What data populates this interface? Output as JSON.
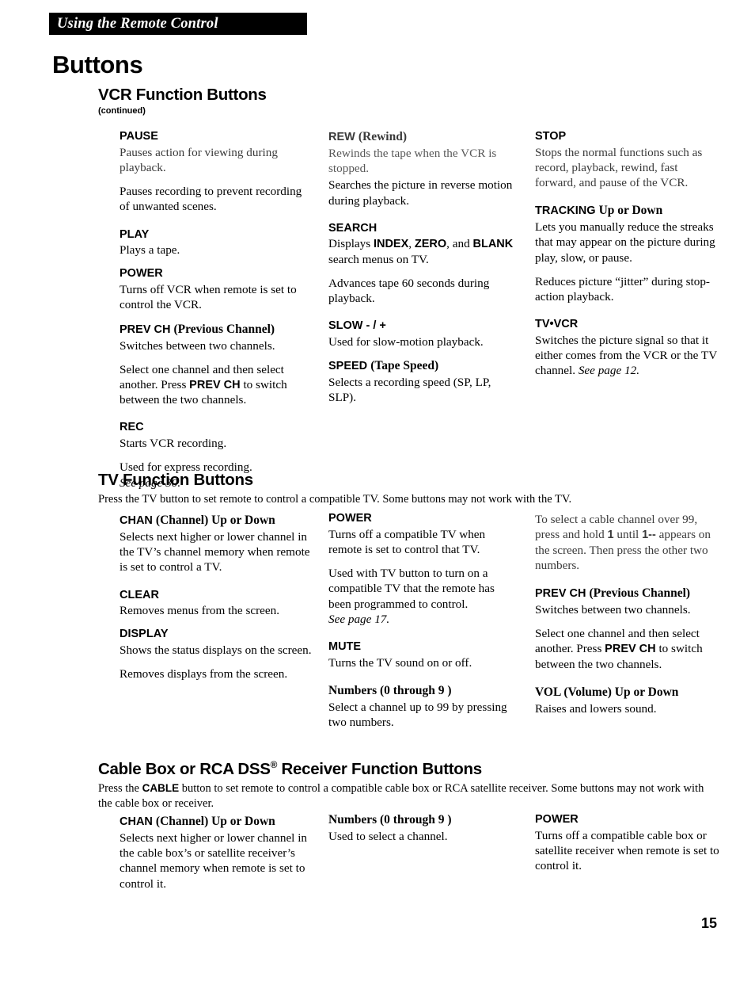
{
  "running_header": "Using the Remote Control",
  "chapter_title": "Buttons",
  "page_number": "15",
  "sections": [
    {
      "id": "vcr",
      "heading": "VCR Function Buttons",
      "subheading": "(continued)",
      "intro": "",
      "columns": [
        {
          "entries": [
            {
              "title": "PAUSE",
              "paragraphs": [
                "Pauses action for viewing during playback.",
                "Pauses recording to prevent recording of unwanted scenes."
              ]
            },
            {
              "title": "PLAY",
              "paragraphs": [
                "Plays a tape."
              ]
            },
            {
              "title": "POWER",
              "paragraphs": [
                "Turns off VCR when remote is set to control the VCR."
              ]
            },
            {
              "title": "PREV CH",
              "title_suffix": "(Previous Channel)",
              "paragraphs": [
                "Switches between two channels.",
                "Select one channel and then select another.  Press PREV CH to switch between the two channels."
              ]
            },
            {
              "title": "REC",
              "paragraphs": [
                "Starts VCR recording.",
                "Used for express recording.",
                "See page 30."
              ]
            }
          ]
        },
        {
          "entries": [
            {
              "title": "REW",
              "title_suffix": "(Rewind)",
              "paragraphs": [
                "Rewinds the tape when the VCR is stopped.",
                "Searches the picture in reverse motion during playback."
              ]
            },
            {
              "title": "SEARCH",
              "paragraphs": [
                "Displays INDEX, ZERO, and BLANK search menus on TV.",
                "Advances tape 60 seconds during playback."
              ]
            },
            {
              "title": "SLOW - / +",
              "paragraphs": [
                "Used for slow-motion playback."
              ]
            },
            {
              "title": "SPEED",
              "title_suffix": "(Tape Speed)",
              "paragraphs": [
                "Selects a recording speed (SP, LP, SLP)."
              ]
            }
          ]
        },
        {
          "entries": [
            {
              "title": "STOP",
              "paragraphs": [
                "Stops the normal functions such as record, playback, rewind, fast forward, and pause of the VCR."
              ]
            },
            {
              "title": "TRACKING",
              "title_suffix": "Up or Down",
              "paragraphs": [
                "Lets you manually reduce the streaks that may appear on the picture during play, slow, or pause.",
                "Reduces picture “jitter” during stop-action playback."
              ]
            },
            {
              "title": "TV•VCR",
              "paragraphs": [
                "Switches the picture signal so that it either comes from the VCR or the TV channel.",
                "See page 12."
              ]
            }
          ]
        }
      ]
    },
    {
      "id": "tv",
      "heading": "TV Function Buttons",
      "subheading": "",
      "intro": "Press the TV button to set remote to control a compatible TV.  Some buttons may not work with the TV.",
      "columns": [
        {
          "entries": [
            {
              "title": "CHAN",
              "title_suffix": "(Channel) Up or Down",
              "paragraphs": [
                "Selects next higher or lower channel in the TV’s channel memory when remote is set to control a TV."
              ]
            },
            {
              "title": "CLEAR",
              "paragraphs": [
                "Removes menus from the screen."
              ]
            },
            {
              "title": "DISPLAY",
              "paragraphs": [
                "Shows the status displays on the screen.",
                "Removes displays from the screen."
              ]
            }
          ]
        },
        {
          "entries": [
            {
              "title": "POWER",
              "paragraphs": [
                "Turns off a compatible TV when remote is set to control that TV.",
                "Used with TV button to turn on a compatible TV that the remote has been programmed to control.",
                "See page 17."
              ]
            },
            {
              "title": "MUTE",
              "paragraphs": [
                "Turns the TV sound on or off."
              ]
            },
            {
              "title": "Numbers (0 through 9 )",
              "serif_title": true,
              "paragraphs": [
                "Select a channel up to 99 by pressing two numbers."
              ]
            }
          ]
        },
        {
          "entries": [
            {
              "title": "",
              "paragraphs": [
                "To select a cable channel over 99, press and hold 1 until 1-- appears on the screen.  Then press the other two numbers."
              ]
            },
            {
              "title": "PREV CH",
              "title_suffix": "(Previous Channel)",
              "paragraphs": [
                "Switches between two channels.",
                "Select one channel and then select another.  Press PREV CH to switch between the two channels."
              ]
            },
            {
              "title": "VOL",
              "title_suffix": "(Volume) Up or Down",
              "paragraphs": [
                "Raises and lowers sound."
              ]
            }
          ]
        }
      ]
    },
    {
      "id": "cable",
      "heading_pre": "Cable Box or RCA DSS",
      "heading_post": " Receiver Function Buttons",
      "heading_sup": "®",
      "subheading": "",
      "intro": "Press the CABLE button to set remote to control a compatible cable box or RCA satellite receiver.  Some buttons may not work with the cable box or receiver.",
      "columns": [
        {
          "entries": [
            {
              "title": "CHAN",
              "title_suffix": "(Channel) Up or Down",
              "paragraphs": [
                "Selects next higher or lower channel in the cable box’s or satellite receiver’s channel memory when remote is set to control it."
              ]
            }
          ]
        },
        {
          "entries": [
            {
              "title": "Numbers (0 through 9 )",
              "serif_title": true,
              "paragraphs": [
                "Used to select a channel."
              ]
            }
          ]
        },
        {
          "entries": [
            {
              "title": "POWER",
              "paragraphs": [
                "Turns off a compatible cable box or satellite receiver when remote is set to control it."
              ]
            }
          ]
        }
      ]
    }
  ]
}
